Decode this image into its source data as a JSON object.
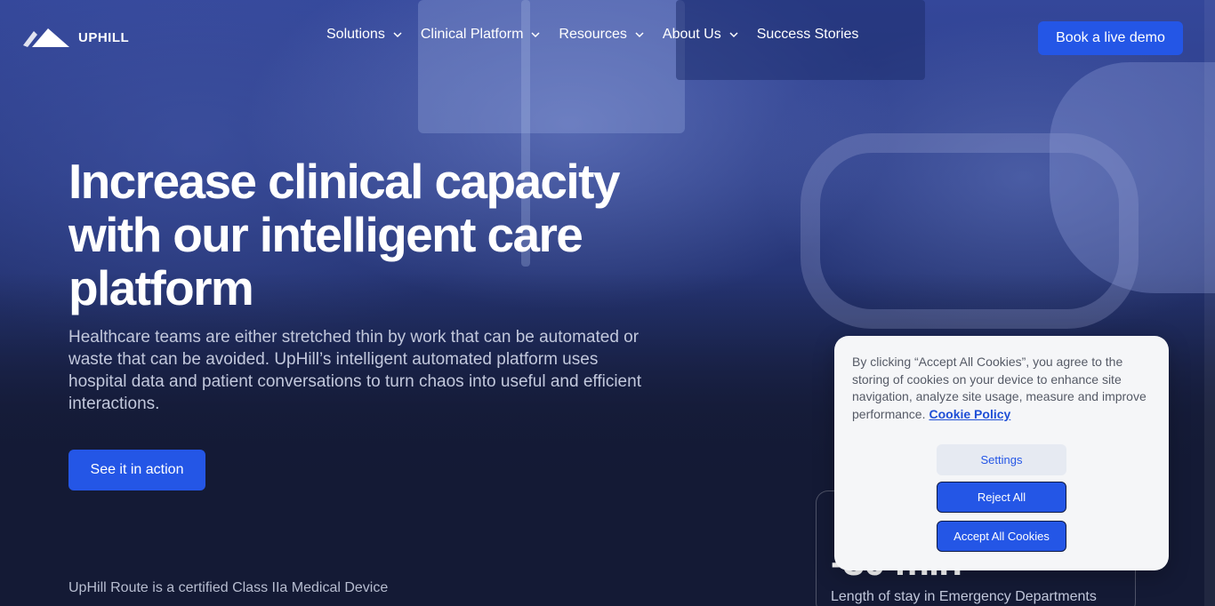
{
  "brand": {
    "name": "UPHILL",
    "primary_color": "#2456e6",
    "background_color": "#141a35"
  },
  "nav": {
    "items": [
      {
        "label": "Solutions",
        "has_dropdown": true,
        "icon": "chevron-down-icon"
      },
      {
        "label": "Clinical Platform",
        "has_dropdown": true,
        "icon": "chevron-down-icon"
      },
      {
        "label": "Resources",
        "has_dropdown": true,
        "icon": "chevron-down-icon"
      },
      {
        "label": "About Us",
        "has_dropdown": true,
        "icon": "chevron-down-icon"
      },
      {
        "label": "Success Stories",
        "has_dropdown": false
      }
    ],
    "demo_button": "Book a live demo"
  },
  "hero": {
    "title": "Increase clinical capacity with our intelligent care platform",
    "subtitle": "Healthcare teams are either stretched thin by work that can be automated or waste that can be avoided. UpHill’s intelligent automated platform uses hospital data and patient conversations to turn chaos into useful and efficient interactions.",
    "cta": "See it in action",
    "certification": "UpHill Route is a certified Class IIa Medical Device"
  },
  "stat": {
    "value": "-30 min",
    "label": "Length of stay in Emergency Departments"
  },
  "cookie_banner": {
    "text": "By clicking “Accept All Cookies”, you agree to the storing of cookies on your device to enhance site navigation, analyze site usage, measure and improve performance.",
    "link": "Cookie Policy",
    "settings": "Settings",
    "reject": "Reject All",
    "accept": "Accept All Cookies"
  }
}
